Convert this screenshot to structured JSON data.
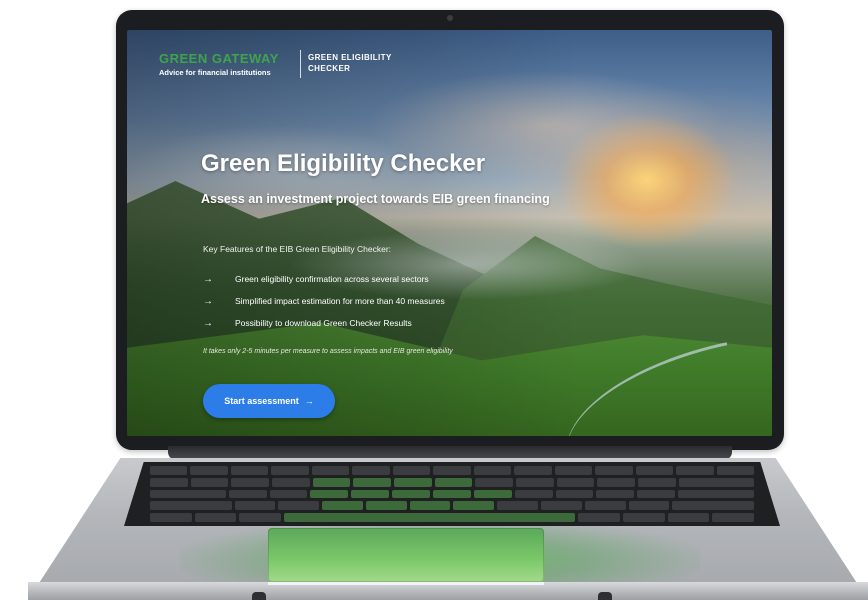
{
  "header": {
    "logo_main": "GREEN GATEWAY",
    "logo_sub": "Advice for financial institutions",
    "product_name": "GREEN ELIGIBILITY CHECKER"
  },
  "hero": {
    "title": "Green Eligibility Checker",
    "subtitle": "Assess an investment project towards EIB green financing"
  },
  "features": {
    "heading": "Key Features of the EIB Green Eligibility Checker:",
    "items": [
      "Green eligibility confirmation across several sectors",
      "Simplified impact estimation for more than 40 measures",
      "Possibility to download Green Checker Results"
    ],
    "arrow": "→"
  },
  "time_note": "It takes only 2-5 minutes per measure to assess impacts and EIB green eligibility",
  "cta": {
    "label": "Start assessment",
    "arrow": "→"
  },
  "colors": {
    "brand_green": "#3fa34d",
    "button_blue": "#2d7de8",
    "bezel": "#1c1d20"
  },
  "icons": [
    "arrow-right-icon"
  ]
}
